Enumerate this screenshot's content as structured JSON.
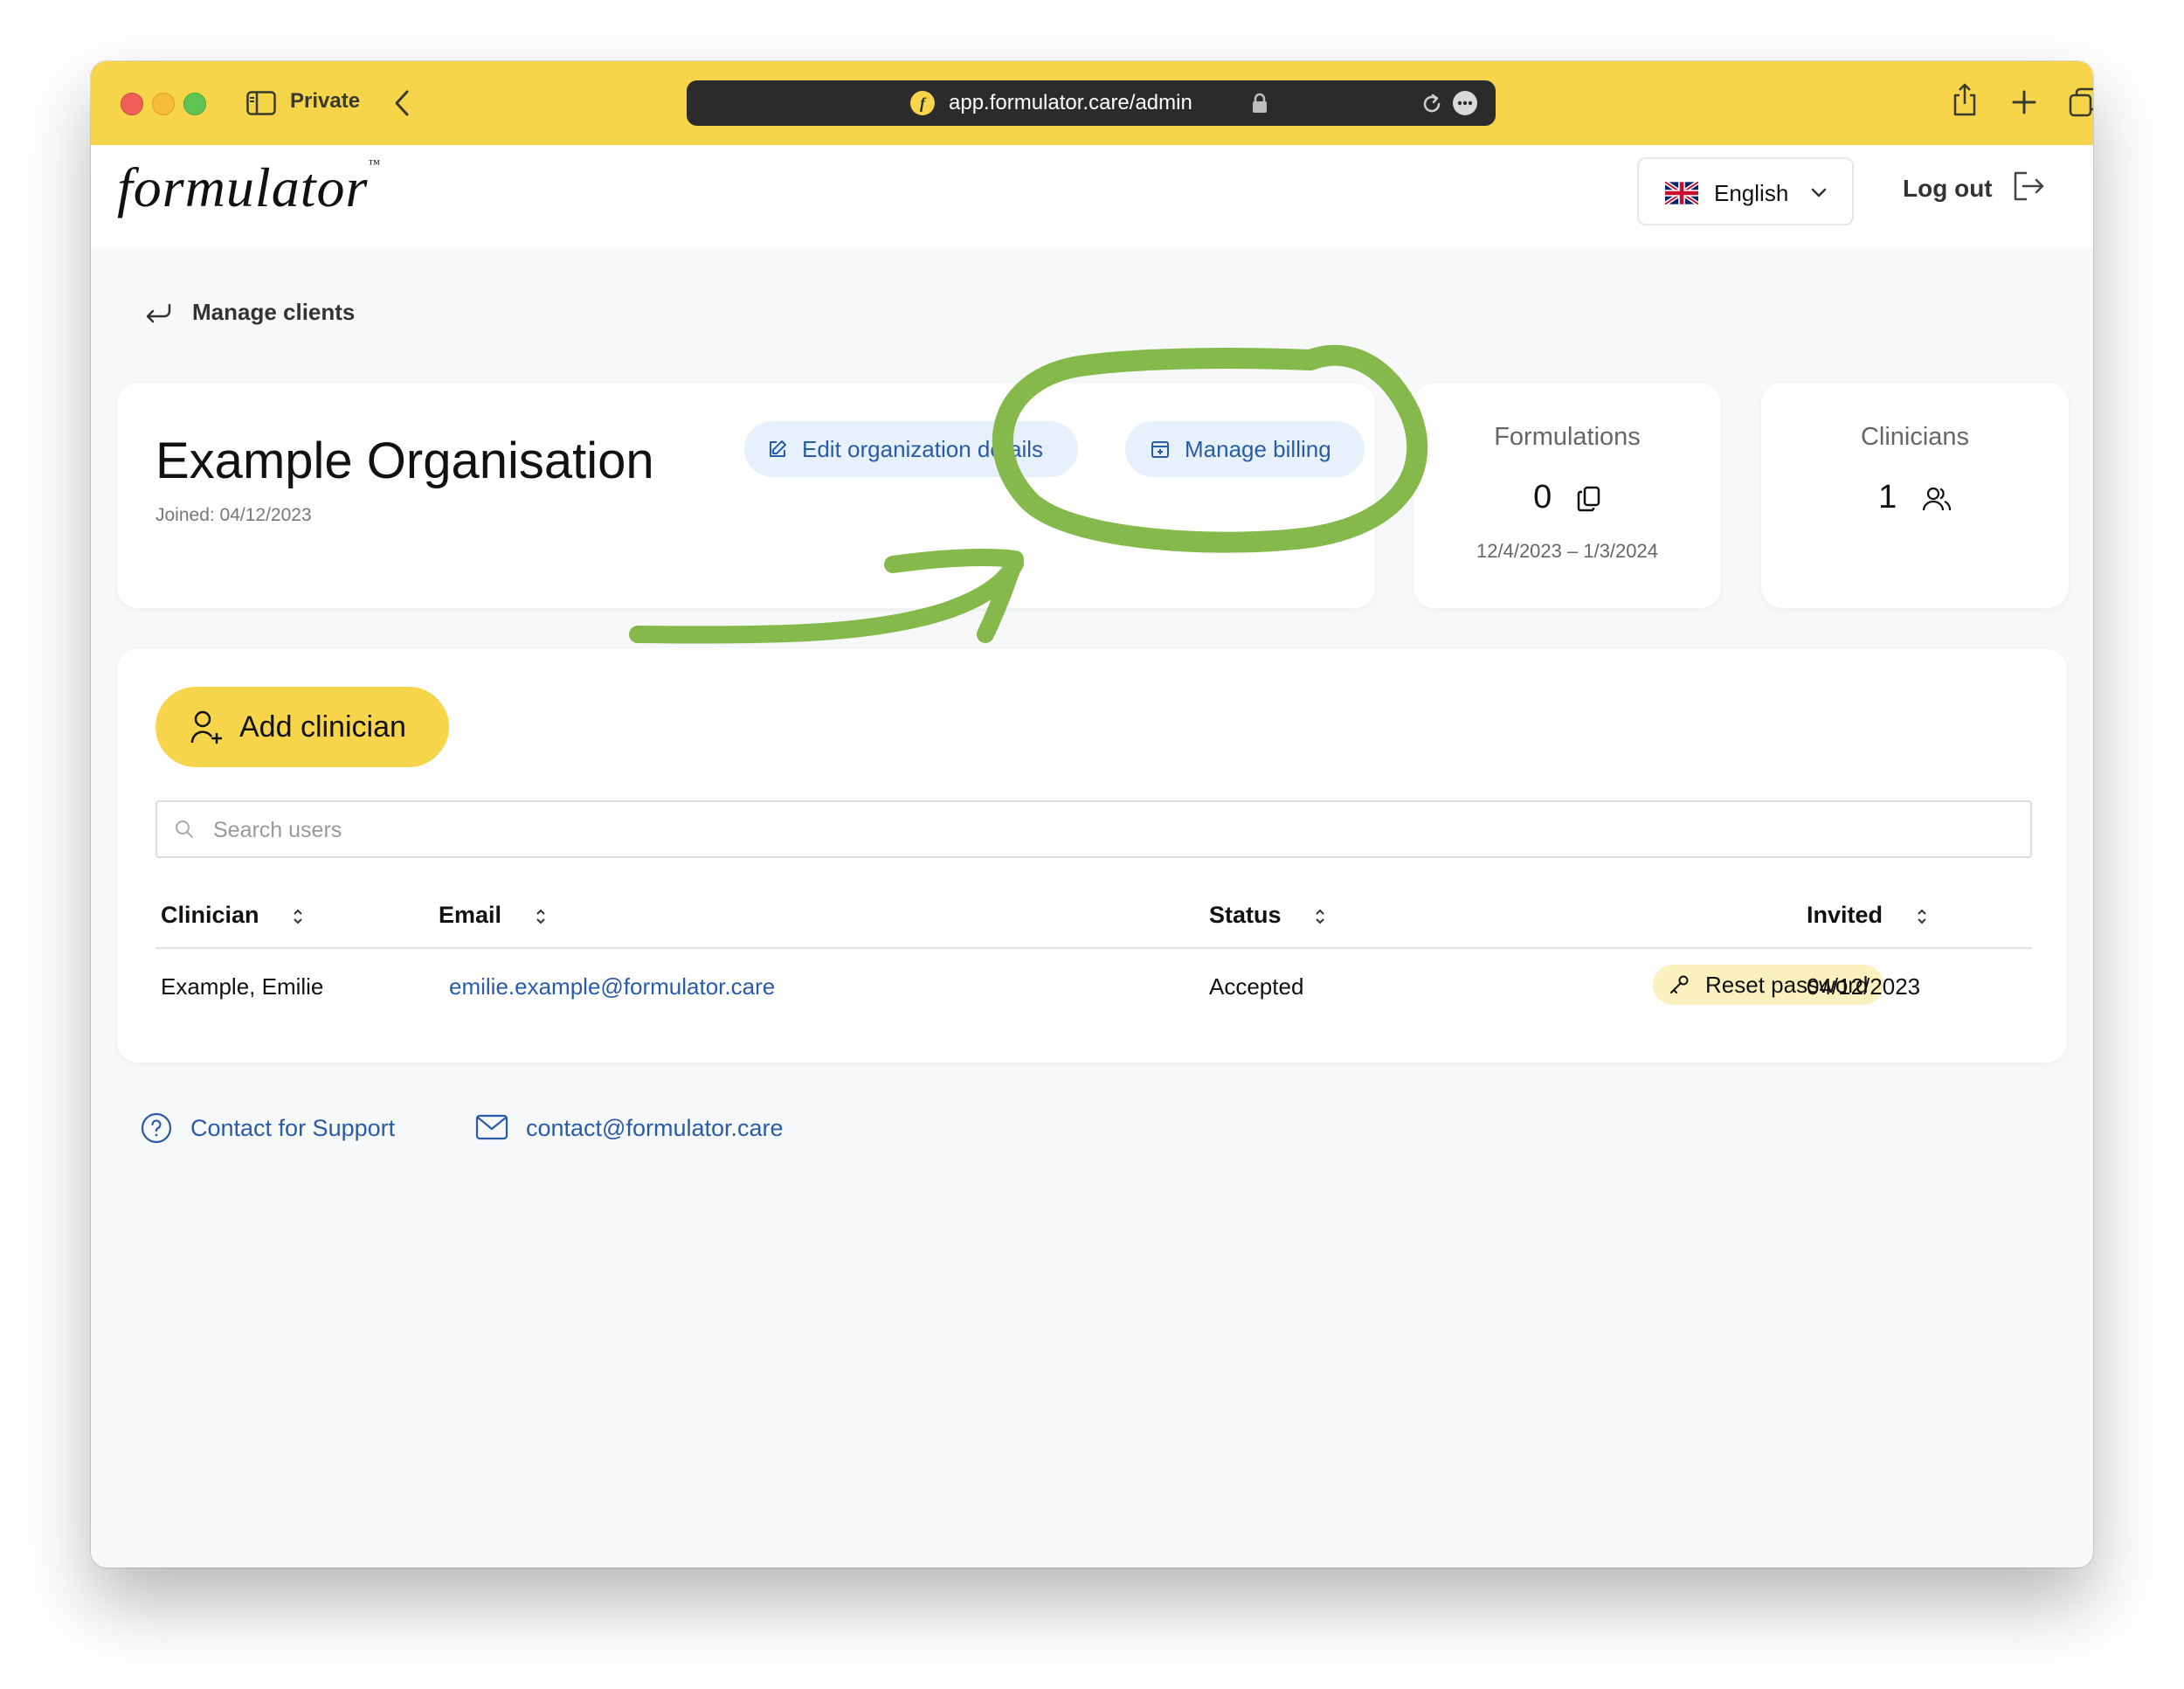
{
  "browser": {
    "private_label": "Private",
    "url": "app.formulator.care/admin"
  },
  "header": {
    "logo": "formulator",
    "logo_tm": "™",
    "language": "English",
    "logout": "Log out"
  },
  "breadcrumb": {
    "back_label": "Manage clients"
  },
  "organization": {
    "name": "Example Organisation",
    "joined": "Joined: 04/12/2023",
    "edit_button": "Edit organization details",
    "billing_button": "Manage billing"
  },
  "stats": {
    "formulations": {
      "label": "Formulations",
      "value": "0",
      "range": "12/4/2023 – 1/3/2024"
    },
    "clinicians": {
      "label": "Clinicians",
      "value": "1"
    }
  },
  "clinicians": {
    "add_button": "Add clinician",
    "search_placeholder": "Search users",
    "columns": [
      "Clinician",
      "Email",
      "Status",
      "Invited"
    ],
    "rows": [
      {
        "name": "Example, Emilie",
        "email": "emilie.example@formulator.care",
        "status": "Accepted",
        "action": "Reset password",
        "invited": "04/12/2023"
      }
    ]
  },
  "footer": {
    "support": "Contact for Support",
    "email": "contact@formulator.care"
  },
  "colors": {
    "brand_yellow": "#f7d54a",
    "link_blue": "#2a5ba8",
    "annotation_green": "#86b94c"
  },
  "icons": {
    "toolbar": [
      "sidebar-icon",
      "back-chevron-icon",
      "lock-icon",
      "reload-icon",
      "more-icon",
      "share-icon",
      "new-tab-icon",
      "tabs-overview-icon"
    ],
    "app": [
      "uk-flag-icon",
      "chevron-down-icon",
      "logout-icon",
      "return-arrow-icon",
      "edit-icon",
      "billing-icon",
      "copy-icon",
      "users-icon",
      "add-user-icon",
      "search-icon",
      "sort-icon",
      "key-icon",
      "help-circle-icon",
      "mail-icon"
    ]
  }
}
